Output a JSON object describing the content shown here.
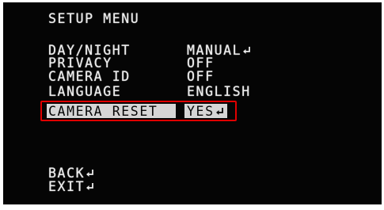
{
  "menu": {
    "title": "SETUP MENU",
    "items": [
      {
        "label": "DAY/NIGHT",
        "value": "MANUAL",
        "has_enter_icon": true
      },
      {
        "label": "PRIVACY",
        "value": "OFF",
        "has_enter_icon": false
      },
      {
        "label": "CAMERA ID",
        "value": "OFF",
        "has_enter_icon": false
      },
      {
        "label": "LANGUAGE",
        "value": "ENGLISH",
        "has_enter_icon": false
      },
      {
        "label": "CAMERA RESET",
        "value": "YES",
        "has_enter_icon": true,
        "selected": true
      }
    ],
    "back_label": "BACK",
    "exit_label": "EXIT"
  },
  "icons": {
    "enter": "return-arrow-icon"
  },
  "colors": {
    "screen_bg": "#050505",
    "osd_text": "#ececec",
    "selection_bg": "#d6d6d6",
    "highlight_border": "#e00000"
  }
}
